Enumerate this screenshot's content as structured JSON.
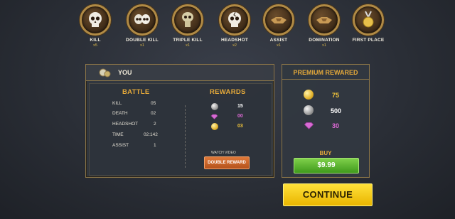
{
  "medals": [
    {
      "name": "KILL",
      "count": "x5",
      "icon": "skull-icon"
    },
    {
      "name": "DOUBLE KILL",
      "count": "x1",
      "icon": "double-skull-icon"
    },
    {
      "name": "TRIPLE KILL",
      "count": "x1",
      "icon": "triple-skull-icon"
    },
    {
      "name": "HEADSHOT",
      "count": "x2",
      "icon": "cracked-skull-icon"
    },
    {
      "name": "ASSIST",
      "count": "x1",
      "icon": "handshake-icon"
    },
    {
      "name": "DOMINATION",
      "count": "x1",
      "icon": "handshake-icon"
    },
    {
      "name": "FIRST PLACE",
      "count": "",
      "icon": "gold-medal-icon"
    }
  ],
  "panel": {
    "header_label": "YOU",
    "battle_title": "BATTLE",
    "rewards_title": "REWARDS",
    "stats": [
      {
        "label": "KILL",
        "value": "05"
      },
      {
        "label": "DEATH",
        "value": "02"
      },
      {
        "label": "HEADSHOT",
        "value": "2"
      },
      {
        "label": "TIME",
        "value": "02:142"
      },
      {
        "label": "ASSIST",
        "value": "1"
      }
    ],
    "rewards": [
      {
        "icon": "silver-coin-icon",
        "value": "15",
        "color": "#ffffff"
      },
      {
        "icon": "pink-gem-icon",
        "value": "00",
        "color": "#e06ad8"
      },
      {
        "icon": "gold-coin-icon",
        "value": "03",
        "color": "#f2c53a"
      }
    ],
    "watch_video_label": "WATCH VIDEO",
    "double_reward_label": "DOUBLE REWARD"
  },
  "premium": {
    "title": "PREMIUM REWARED",
    "items": [
      {
        "icon": "gold-coin-icon",
        "value": "75",
        "color": "#f2c53a"
      },
      {
        "icon": "silver-coin-icon",
        "value": "500",
        "color": "#ffffff"
      },
      {
        "icon": "pink-gem-icon",
        "value": "30",
        "color": "#e06ad8"
      }
    ],
    "buy_label": "BUY",
    "price": "$9.99"
  },
  "continue_label": "CONTINUE"
}
